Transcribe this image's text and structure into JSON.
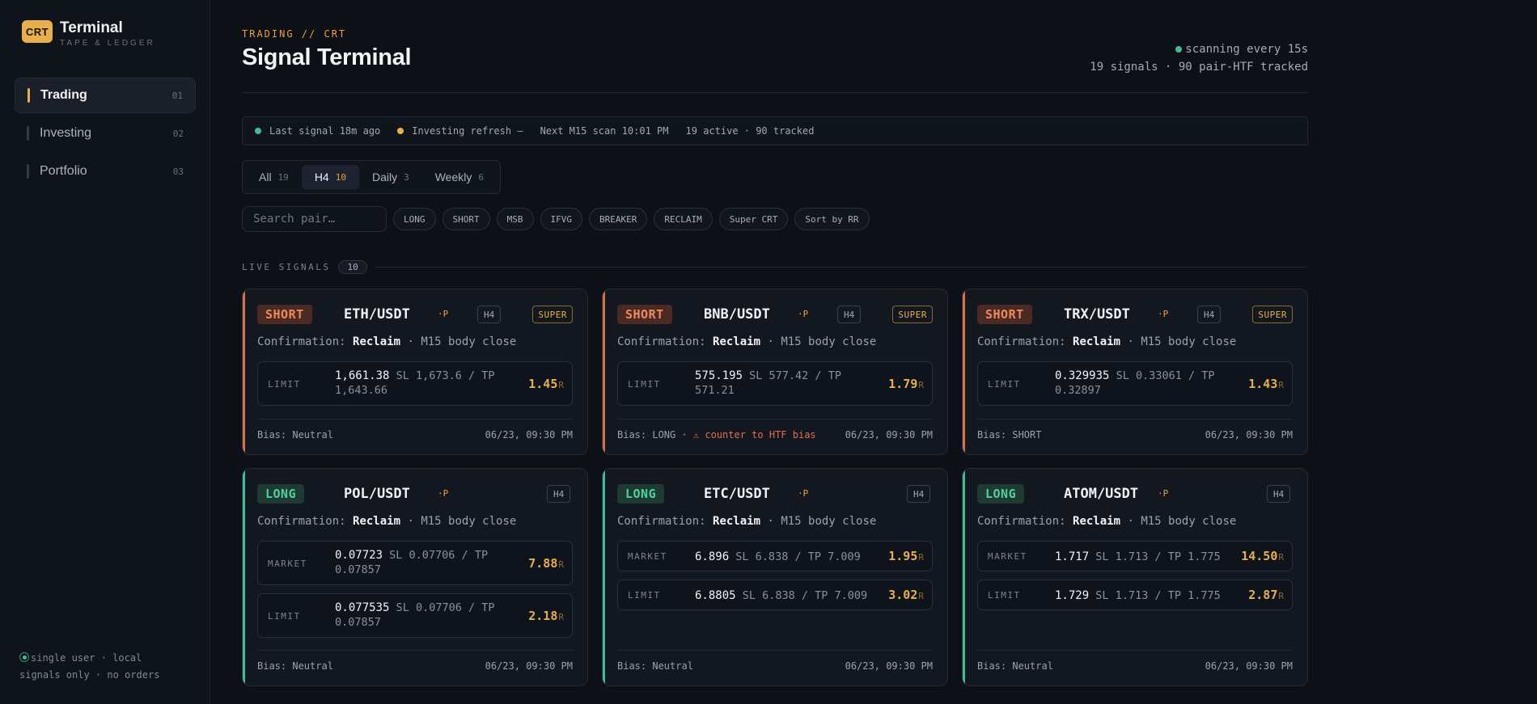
{
  "brand": {
    "badge": "CRT",
    "title": "Terminal",
    "subtitle": "TAPE & LEDGER"
  },
  "nav": [
    {
      "label": "Trading",
      "num": "01",
      "active": true
    },
    {
      "label": "Investing",
      "num": "02",
      "active": false
    },
    {
      "label": "Portfolio",
      "num": "03",
      "active": false
    }
  ],
  "sidebar_footer": {
    "line1": "single user · local",
    "line2": "signals only · no orders"
  },
  "header": {
    "eyebrow": "TRADING // CRT",
    "title": "Signal Terminal",
    "status_line1": "scanning every 15s",
    "status_line2": "19 signals · 90 pair-HTF tracked"
  },
  "info_bar": {
    "last_signal": "Last signal 18m ago",
    "investing": "Investing refresh —",
    "next_scan": "Next M15 scan 10:01 PM",
    "active": "19 active · 90 tracked"
  },
  "tabs": [
    {
      "label": "All",
      "count": "19"
    },
    {
      "label": "H4",
      "count": "10"
    },
    {
      "label": "Daily",
      "count": "3"
    },
    {
      "label": "Weekly",
      "count": "6"
    }
  ],
  "search": {
    "placeholder": "Search pair…"
  },
  "chips": [
    "LONG",
    "SHORT",
    "MSB",
    "IFVG",
    "BREAKER",
    "RECLAIM",
    "Super CRT",
    "Sort by RR"
  ],
  "section": {
    "title": "LIVE SIGNALS",
    "count": "10"
  },
  "cards": [
    {
      "side": "SHORT",
      "pair": "ETH/USDT",
      "p": "·P",
      "tf": "H4",
      "super": "SUPER",
      "confirm_prefix": "Confirmation:",
      "confirm_type": "Reclaim",
      "confirm_suffix": "· M15 body close",
      "orders": [
        {
          "type": "LIMIT",
          "entry": "1,661.38",
          "sltp": "SL 1,673.6 / TP",
          "sltp2": "1,643.66",
          "rr": "1.45",
          "r": "R"
        }
      ],
      "bias": "Bias: Neutral",
      "warn": "",
      "time": "06/23, 09:30 PM"
    },
    {
      "side": "SHORT",
      "pair": "BNB/USDT",
      "p": "·P",
      "tf": "H4",
      "super": "SUPER",
      "confirm_prefix": "Confirmation:",
      "confirm_type": "Reclaim",
      "confirm_suffix": "· M15 body close",
      "orders": [
        {
          "type": "LIMIT",
          "entry": "575.195",
          "sltp": "SL 577.42 / TP",
          "sltp2": "571.21",
          "rr": "1.79",
          "r": "R"
        }
      ],
      "bias": "Bias: LONG ·",
      "warn": "⚠ counter to HTF bias",
      "time": "06/23, 09:30 PM"
    },
    {
      "side": "SHORT",
      "pair": "TRX/USDT",
      "p": "·P",
      "tf": "H4",
      "super": "SUPER",
      "confirm_prefix": "Confirmation:",
      "confirm_type": "Reclaim",
      "confirm_suffix": "· M15 body close",
      "orders": [
        {
          "type": "LIMIT",
          "entry": "0.329935",
          "sltp": "SL 0.33061 / TP",
          "sltp2": "0.32897",
          "rr": "1.43",
          "r": "R"
        }
      ],
      "bias": "Bias: SHORT",
      "warn": "",
      "time": "06/23, 09:30 PM"
    },
    {
      "side": "LONG",
      "pair": "POL/USDT",
      "p": "·P",
      "tf": "H4",
      "super": "",
      "confirm_prefix": "Confirmation:",
      "confirm_type": "Reclaim",
      "confirm_suffix": "· M15 body close",
      "orders": [
        {
          "type": "MARKET",
          "entry": "0.07723",
          "sltp": "SL 0.07706 / TP",
          "sltp2": "0.07857",
          "rr": "7.88",
          "r": "R"
        },
        {
          "type": "LIMIT",
          "entry": "0.077535",
          "sltp": "SL 0.07706 / TP",
          "sltp2": "0.07857",
          "rr": "2.18",
          "r": "R"
        }
      ],
      "bias": "Bias: Neutral",
      "warn": "",
      "time": "06/23, 09:30 PM"
    },
    {
      "side": "LONG",
      "pair": "ETC/USDT",
      "p": "·P",
      "tf": "H4",
      "super": "",
      "confirm_prefix": "Confirmation:",
      "confirm_type": "Reclaim",
      "confirm_suffix": "· M15 body close",
      "orders": [
        {
          "type": "MARKET",
          "entry": "6.896",
          "sltp": "SL 6.838 / TP 7.009",
          "sltp2": "",
          "rr": "1.95",
          "r": "R"
        },
        {
          "type": "LIMIT",
          "entry": "6.8805",
          "sltp": "SL 6.838 / TP 7.009",
          "sltp2": "",
          "rr": "3.02",
          "r": "R"
        }
      ],
      "bias": "Bias: Neutral",
      "warn": "",
      "time": "06/23, 09:30 PM"
    },
    {
      "side": "LONG",
      "pair": "ATOM/USDT",
      "p": "·P",
      "tf": "H4",
      "super": "",
      "confirm_prefix": "Confirmation:",
      "confirm_type": "Reclaim",
      "confirm_suffix": "· M15 body close",
      "orders": [
        {
          "type": "MARKET",
          "entry": "1.717",
          "sltp": "SL 1.713 / TP 1.775",
          "sltp2": "",
          "rr": "14.50",
          "r": "R"
        },
        {
          "type": "LIMIT",
          "entry": "1.729",
          "sltp": "SL 1.713 / TP 1.775",
          "sltp2": "",
          "rr": "2.87",
          "r": "R"
        }
      ],
      "bias": "Bias: Neutral",
      "warn": "",
      "time": "06/23, 09:30 PM"
    }
  ],
  "colors": {
    "accent": "#e8b04b",
    "short": "#d9704a",
    "long": "#3fbf8f",
    "background": "#0d1016"
  }
}
